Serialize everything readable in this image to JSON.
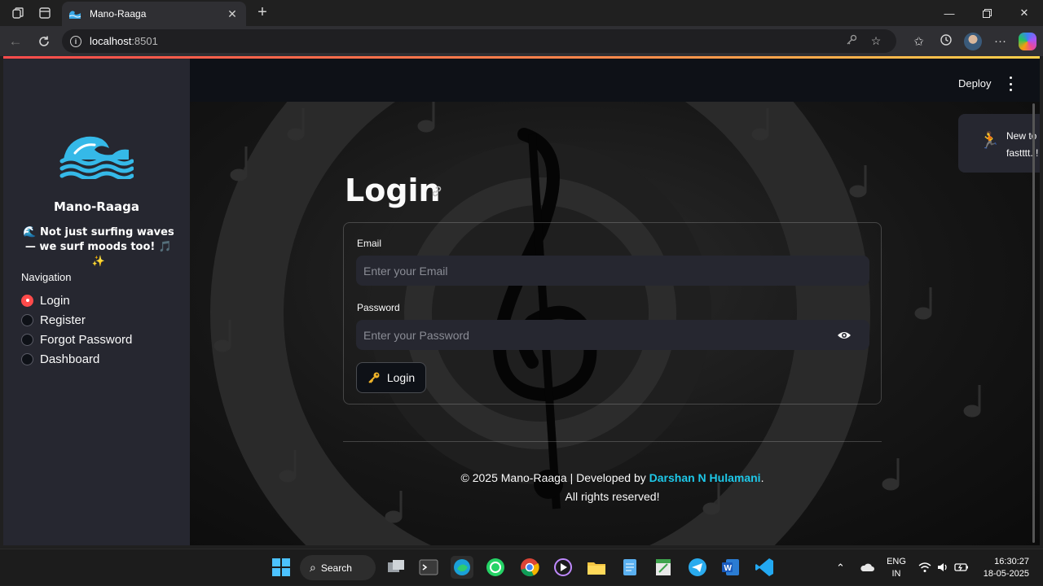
{
  "browser": {
    "tab_title": "Mano-Raaga",
    "url_host": "localhost",
    "url_port": ":8501"
  },
  "app": {
    "header": {
      "deploy_label": "Deploy"
    },
    "sidebar": {
      "brand": "Mano-Raaga",
      "tagline": "🌊 Not just surfing waves — we surf moods too! 🎵 ✨",
      "nav_title": "Navigation",
      "nav_items": [
        {
          "label": "Login",
          "selected": true
        },
        {
          "label": "Register",
          "selected": false
        },
        {
          "label": "Forgot Password",
          "selected": false
        },
        {
          "label": "Dashboard",
          "selected": false
        }
      ]
    },
    "main": {
      "title": "Login",
      "email_label": "Email",
      "email_placeholder": "Enter your Email",
      "password_label": "Password",
      "password_placeholder": "Enter your Password",
      "login_button": "Login",
      "footer_line1_prefix": "© 2025 Mano-Raaga | Developed by ",
      "footer_author": "Darshan N Hulamani",
      "footer_line1_suffix": ".",
      "footer_line2": "All rights reserved!"
    },
    "toast": {
      "icon": "running-person-icon",
      "text": "New to Mano-Raag? Register it fastttt..!"
    },
    "colors": {
      "accent": "#ff4b4b",
      "author_link": "#1ec8e8",
      "sidebar_bg": "#262730",
      "app_bg": "#0e1117"
    }
  },
  "taskbar": {
    "search_label": "Search",
    "lang_line1": "ENG",
    "lang_line2": "IN",
    "time": "16:30:27",
    "date": "18-05-2025"
  }
}
